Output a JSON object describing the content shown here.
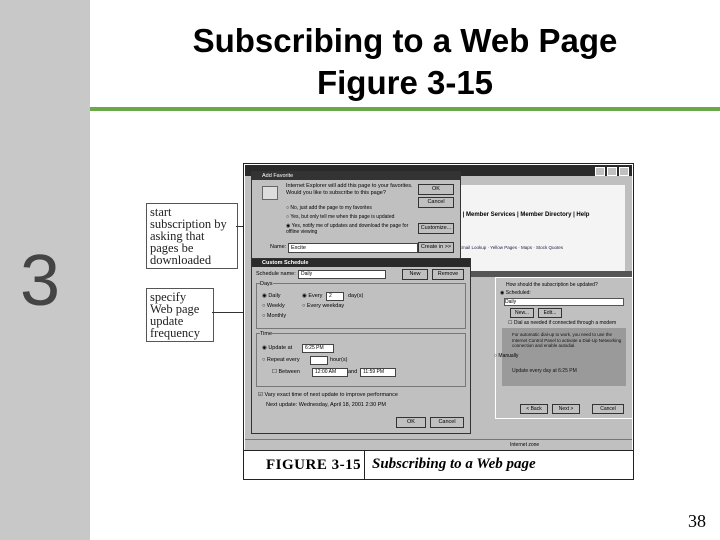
{
  "slide": {
    "title_line1": "Subscribing to a Web Page",
    "title_line2": "Figure 3-15",
    "chapter_number": "3",
    "page_number": "38"
  },
  "callouts": [
    {
      "text": "start subscription by asking that pages be downloaded"
    },
    {
      "text": "specify Web page update frequency"
    }
  ],
  "figure": {
    "label": "FIGURE 3-15",
    "caption": "Subscribing to a Web page"
  },
  "browser": {
    "nav_links": "t | Member Services | Member Directory | Help",
    "status_text": "Internet zone"
  },
  "add_favorite_dialog": {
    "title": "Add Favorite",
    "question_line1": "Internet Explorer will add this page to your favorites.",
    "question_line2": "Would you like to subscribe to this page?",
    "option1": "No, just add the page to my favorites",
    "option2": "Yes, but only tell me when this page is updated",
    "option3": "Yes, notify me of updates and download the page for offline viewing",
    "ok_label": "OK",
    "cancel_label": "Cancel",
    "customize_label": "Customize...",
    "create_in_label": "Create in >>",
    "name_label": "Name:",
    "name_value": "Excite"
  },
  "custom_schedule_dialog": {
    "title": "Custom Schedule",
    "schedule_name_label": "Schedule name:",
    "schedule_name_value": "Daily",
    "new_label": "New",
    "remove_label": "Remove",
    "days_label": "Days",
    "daily_label": "Daily",
    "weekly_label": "Weekly",
    "monthly_label": "Monthly",
    "every_label": "Every",
    "every_value": "2",
    "days_unit": "day(s)",
    "every_weekday_label": "Every weekday",
    "time_label": "Time",
    "update_at_label": "Update at",
    "update_at_value": "6:25 PM",
    "repeat_every_label": "Repeat every",
    "hours_unit": "hour(s)",
    "between_label": "Between",
    "between_from": "12:00 AM",
    "and_label": "and",
    "between_to": "11:59 PM",
    "vary_label": "Vary exact time of next update to improve performance",
    "next_update": "Next update: Wednesday, April 18, 2001 2:30 PM",
    "ok_label": "OK",
    "cancel_label": "Cancel"
  },
  "wizard": {
    "question": "How should the subscription be updated?",
    "scheduled_label": "Scheduled:",
    "schedule_value": "Daily",
    "new_label": "New...",
    "edit_label": "Edit...",
    "dialup_label": "Dial as needed if connected through a modem",
    "hint": "For automatic dial-up to work, you need to use the Internet Control Panel to activate a Dial-Up Networking connection and enable autodial.",
    "manually_label": "Manually",
    "update_every": "Update every day at 6:25 PM",
    "back_label": "< Back",
    "next_label": "Next >",
    "cancel_label": "Cancel"
  },
  "colors": {
    "left_band": "#c8c8c8",
    "rule": "#6aa94a",
    "chrome": "#c0c0c0",
    "titlebar": "#2a2a2a"
  }
}
